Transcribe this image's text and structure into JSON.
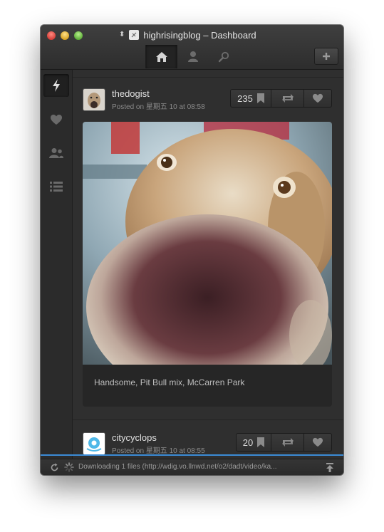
{
  "window": {
    "title": "highrisingblog – Dashboard"
  },
  "tabs": [
    {
      "name": "home-icon",
      "active": true
    },
    {
      "name": "user-icon",
      "active": false
    },
    {
      "name": "search-icon",
      "active": false
    }
  ],
  "toolbar": {
    "add_icon": "plus-icon"
  },
  "sidebar": {
    "items": [
      {
        "icon": "lightning-icon",
        "active": true
      },
      {
        "icon": "heart-icon",
        "active": false
      },
      {
        "icon": "people-icon",
        "active": false
      },
      {
        "icon": "list-icon",
        "active": false
      }
    ]
  },
  "posts": [
    {
      "username": "thedogist",
      "posted": "Posted on 星期五 10 at 08:58",
      "notes_count": "235",
      "caption": "Handsome, Pit Bull mix, McCarren Park"
    },
    {
      "username": "citycyclops",
      "posted": "Posted on 星期五 10 at 08:55",
      "notes_count": "20"
    }
  ],
  "status": {
    "text": "Downloading 1 files (http://wdig.vo.llnwd.net/o2/dadt/video/ka..."
  },
  "colors": {
    "progress": "#3b8bd6",
    "window_bg": "#2b2b2b"
  }
}
